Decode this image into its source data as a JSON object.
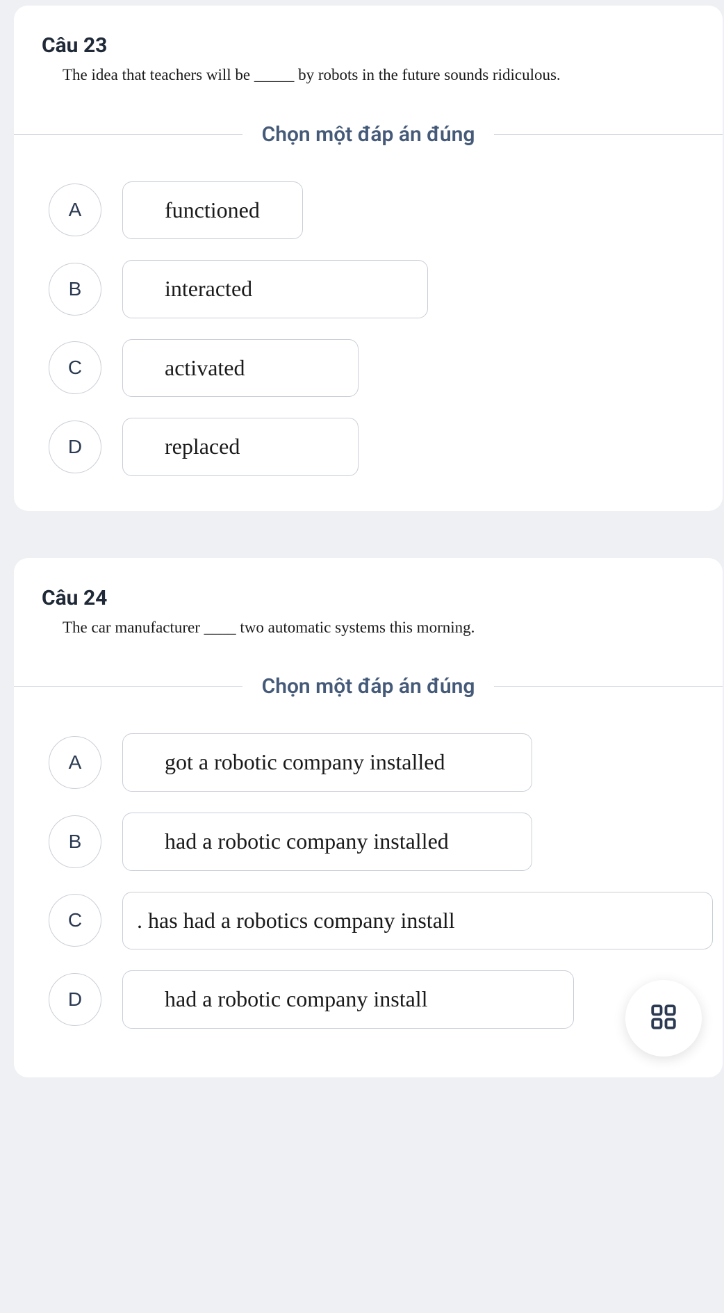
{
  "questions": [
    {
      "title": "Câu 23",
      "text": "The idea that teachers will be _____ by robots in the future sounds ridiculous.",
      "prompt": "Chọn một đáp án đúng",
      "options": [
        {
          "letter": "A",
          "text": "functioned"
        },
        {
          "letter": "B",
          "text": "interacted"
        },
        {
          "letter": "C",
          "text": "activated"
        },
        {
          "letter": "D",
          "text": "replaced"
        }
      ]
    },
    {
      "title": "Câu 24",
      "text": "The car manufacturer ____ two automatic systems this morning.",
      "prompt": "Chọn một đáp án đúng",
      "options": [
        {
          "letter": "A",
          "text": "got a robotic company installed"
        },
        {
          "letter": "B",
          "text": "had a robotic company installed"
        },
        {
          "letter": "C",
          "text": ". has had a robotics company install"
        },
        {
          "letter": "D",
          "text": "had a robotic company install"
        }
      ]
    }
  ]
}
